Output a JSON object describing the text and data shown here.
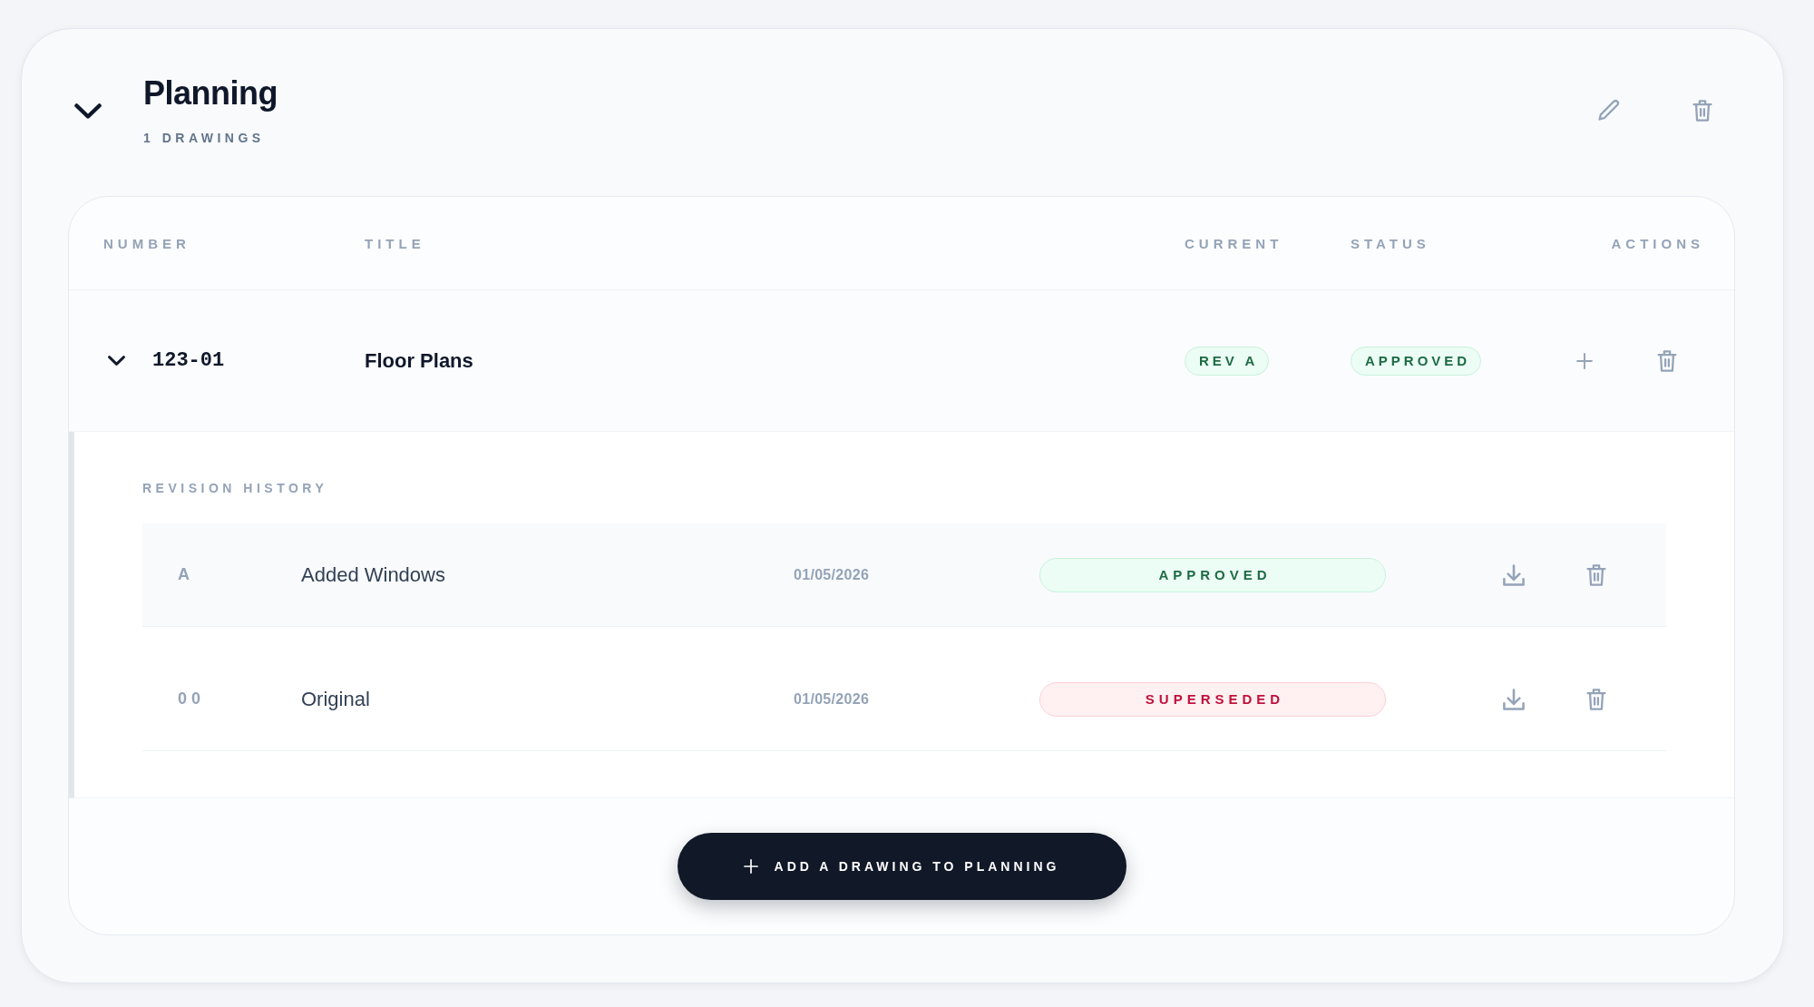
{
  "group": {
    "title": "Planning",
    "count": "1 DRAWINGS",
    "expanded": true
  },
  "table": {
    "columns": [
      "NUMBER",
      "TITLE",
      "CURRENT",
      "STATUS",
      "ACTIONS"
    ],
    "rows": [
      {
        "number": "123-01",
        "title": "Floor Plans",
        "current": "REV A",
        "status": {
          "label": "APPROVED",
          "kind": "approved"
        },
        "expanded": true,
        "history_heading": "REVISION HISTORY",
        "revisions": [
          {
            "revision": "A",
            "description": "Added Windows",
            "date": "01/05/2026",
            "status": {
              "label": "APPROVED",
              "kind": "approved"
            },
            "highlighted": true
          },
          {
            "revision": "00",
            "description": "Original",
            "date": "01/05/2026",
            "status": {
              "label": "SUPERSEDED",
              "kind": "superseded"
            },
            "highlighted": false
          }
        ]
      }
    ]
  },
  "add_button": {
    "label": "ADD A DRAWING TO PLANNING"
  }
}
